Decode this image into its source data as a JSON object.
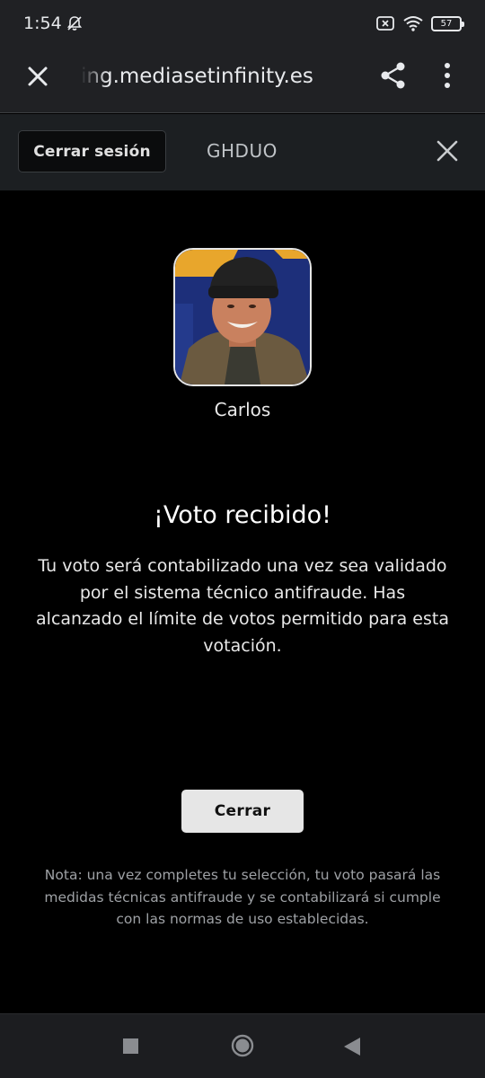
{
  "status_bar": {
    "time": "1:54",
    "battery": "57",
    "icons": [
      "bell-off-icon",
      "sim-x-icon",
      "wifi-icon",
      "battery-icon"
    ]
  },
  "browser": {
    "url": "ing.mediasetinfinity.es",
    "icons": [
      "close-icon",
      "share-icon",
      "more-vert-icon"
    ]
  },
  "session": {
    "logout_label": "Cerrar sesión",
    "user_code": "GHDUO",
    "close_icon": "close-icon"
  },
  "contestant": {
    "name": "Carlos"
  },
  "vote": {
    "title": "¡Voto recibido!",
    "message": "Tu voto será contabilizado una vez sea validado por el sistema técnico antifraude. Has alcanzado el límite de votos permitido para esta votación.",
    "close_label": "Cerrar",
    "note": "Nota: una vez completes tu selección, tu voto pasará las medidas técnicas antifraude y se contabilizará si cumple con las normas de uso establecidas."
  },
  "nav_bar": {
    "icons": [
      "recents-icon",
      "home-icon",
      "back-icon"
    ]
  }
}
